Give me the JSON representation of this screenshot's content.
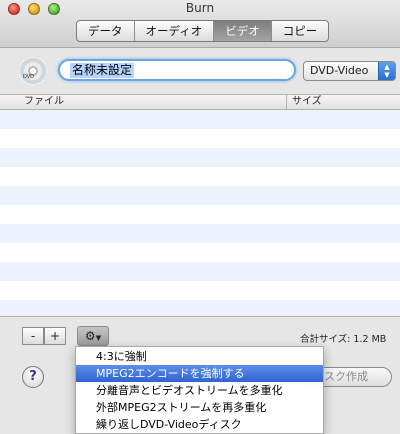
{
  "window": {
    "title": "Burn"
  },
  "tabs": [
    {
      "label": "データ"
    },
    {
      "label": "オーディオ"
    },
    {
      "label": "ビデオ",
      "active": true
    },
    {
      "label": "コピー"
    }
  ],
  "disc_icon": {
    "name": "dvd-disc-icon",
    "label": "DVD"
  },
  "name_field": {
    "value": "名称未設定"
  },
  "format_popup": {
    "selected": "DVD-Video"
  },
  "list": {
    "columns": [
      "ファイル",
      "サイズ"
    ],
    "rows": []
  },
  "toolbar": {
    "remove_label": "-",
    "add_label": "+",
    "gear_icon": "gear-icon",
    "total_size": "合計サイズ: 1.2 MB"
  },
  "help_label": "?",
  "burn_button_label": "スク作成",
  "menu": {
    "items": [
      {
        "label": "4:3に強制",
        "highlighted": false
      },
      {
        "label": "MPEG2エンコードを強制する",
        "highlighted": true
      },
      {
        "label": "分離音声とビデオストリームを多重化",
        "highlighted": false
      },
      {
        "label": "外部MPEG2ストリームを再多重化",
        "highlighted": false
      },
      {
        "label": "繰り返しDVD-Videoディスク",
        "highlighted": false
      }
    ]
  },
  "colors": {
    "highlight": "#2f63d3",
    "selection": "#b5d5ff",
    "stripe": "#edf3fe"
  }
}
